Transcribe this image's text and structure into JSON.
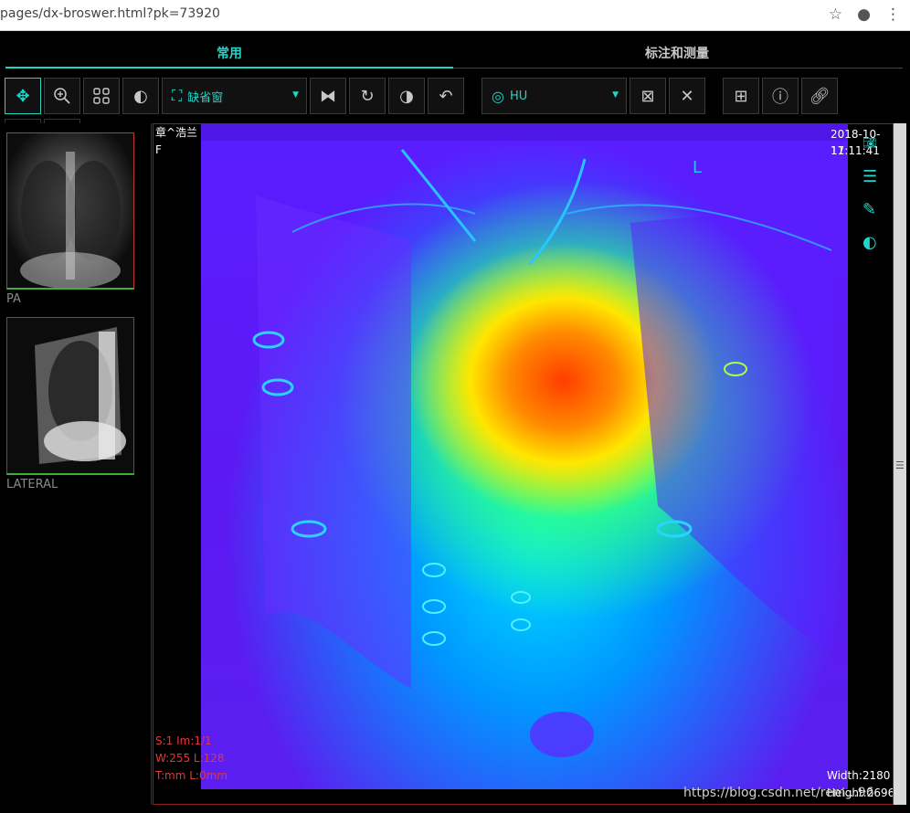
{
  "browser": {
    "url": "pages/dx-broswer.html?pk=73920"
  },
  "tabs": {
    "common": "常用",
    "annotate": "标注和测量"
  },
  "toolbar": {
    "window_preset": "缺省窗",
    "hu_select": "HU"
  },
  "thumbnails": [
    {
      "label": "PA"
    },
    {
      "label": "LATERAL"
    }
  ],
  "overlay": {
    "patient_name": "章^浩兰",
    "patient_sex": "F",
    "date": "2018-10-17",
    "time": "11:11:41",
    "series_info": "S:1 Im:1/1",
    "window_info": "W:255 L:128",
    "thickness_info": "T:mm L:0mm",
    "width_info": "Width:2180",
    "height_info": "Height:2696",
    "orientation_marker": "L"
  },
  "watermark": "https://blog.csdn.net/rem...96",
  "colors": {
    "accent": "#1fd6c8",
    "viewer_border": "#8a2020",
    "status_green": "#3fae3a"
  }
}
